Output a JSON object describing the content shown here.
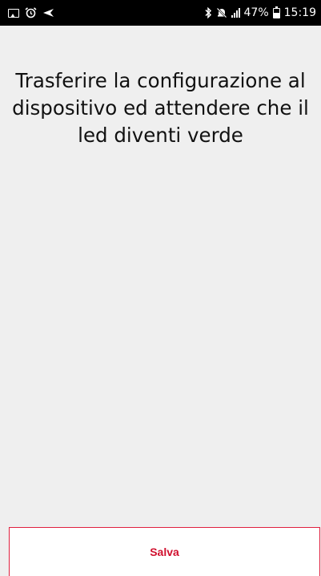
{
  "status_bar": {
    "icons_left": [
      "image-icon",
      "alarm-icon",
      "send-icon"
    ],
    "icons_right": [
      "bluetooth-icon",
      "silent-icon",
      "signal-icon",
      "battery-icon"
    ],
    "signal_label": ".ıl",
    "battery_percent": "47%",
    "battery_level": 0.47,
    "time": "15:19"
  },
  "main": {
    "message": "Trasferire la configurazione al dispositivo ed attendere che il led diventi verde"
  },
  "footer": {
    "save_label": "Salva",
    "accent_color": "#d0102e"
  }
}
